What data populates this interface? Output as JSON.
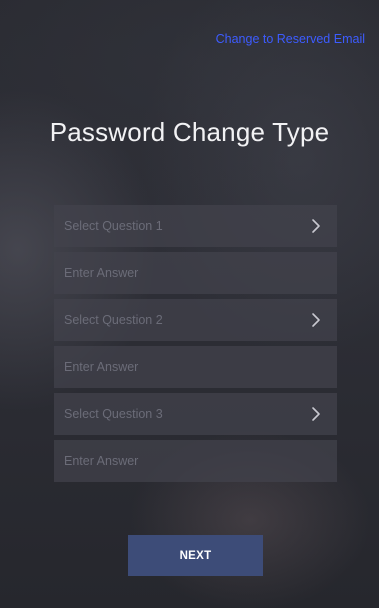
{
  "header": {
    "reserved_email_link": "Change to Reserved Email"
  },
  "page_title": "Password Change Type",
  "form": {
    "question_1": {
      "label": "Select Question 1",
      "icon": "chevron-right-icon"
    },
    "answer_1": {
      "placeholder": "Enter Answer",
      "value": ""
    },
    "question_2": {
      "label": "Select Question 2",
      "icon": "chevron-right-icon"
    },
    "answer_2": {
      "placeholder": "Enter Answer",
      "value": ""
    },
    "question_3": {
      "label": "Select Question 3",
      "icon": "chevron-right-icon"
    },
    "answer_3": {
      "placeholder": "Enter Answer",
      "value": ""
    }
  },
  "next_button": {
    "label": "NEXT"
  },
  "colors": {
    "link": "#3d5cff",
    "button": "#3d4c78",
    "field": "#42424c",
    "placeholder": "#6b6c78"
  }
}
